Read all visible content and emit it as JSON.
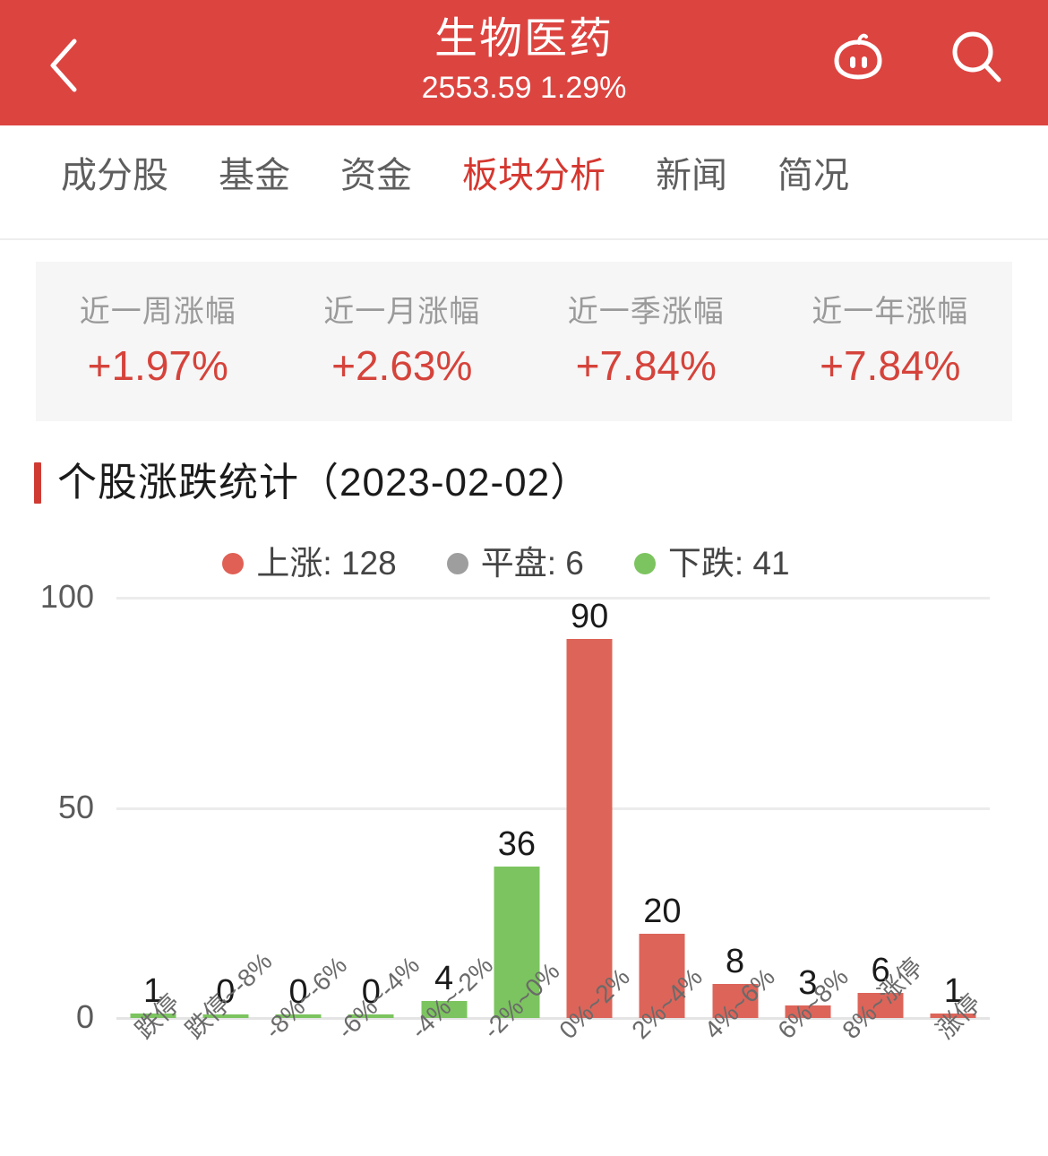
{
  "header": {
    "back_icon": "chevron-left-icon",
    "title": "生物医药",
    "subtitle": "2553.59 1.29%",
    "robot_icon": "robot-icon",
    "search_icon": "search-icon",
    "background_color": "#dc4440"
  },
  "tabs": [
    {
      "label": "成分股",
      "active": false
    },
    {
      "label": "基金",
      "active": false
    },
    {
      "label": "资金",
      "active": false
    },
    {
      "label": "板块分析",
      "active": true
    },
    {
      "label": "新闻",
      "active": false
    },
    {
      "label": "简况",
      "active": false
    }
  ],
  "stats": [
    {
      "label": "近一周涨幅",
      "value": "+1.97%"
    },
    {
      "label": "近一月涨幅",
      "value": "+2.63%"
    },
    {
      "label": "近一季涨幅",
      "value": "+7.84%"
    },
    {
      "label": "近一年涨幅",
      "value": "+7.84%"
    }
  ],
  "section": {
    "title": "个股涨跌统计（2023-02-02）"
  },
  "legend": [
    {
      "label": "上涨: 128",
      "color": "#e06055"
    },
    {
      "label": "平盘: 6",
      "color": "#9e9e9e"
    },
    {
      "label": "下跌: 41",
      "color": "#7cc45f"
    }
  ],
  "colors": {
    "up_red": "#dd6459",
    "flat_gray": "#9e9e9e",
    "down_green": "#7cc45f",
    "brand_red": "#dc4440",
    "panel_gray": "#f6f6f6"
  },
  "chart_data": {
    "type": "bar",
    "title": "个股涨跌统计（2023-02-02）",
    "xlabel": "",
    "ylabel": "",
    "ylim": [
      0,
      100
    ],
    "yticks": [
      "0",
      "50",
      "100"
    ],
    "grid": true,
    "legend_position": "top-right",
    "categories": [
      "跌停",
      "跌停~-8%",
      "-8%~-6%",
      "-6%~-4%",
      "-4%~-2%",
      "-2%~0%",
      "0%~2%",
      "2%~4%",
      "4%~6%",
      "6%~8%",
      "8%~涨停",
      "涨停"
    ],
    "values": [
      1,
      0,
      0,
      0,
      4,
      36,
      90,
      20,
      8,
      3,
      6,
      1
    ],
    "bar_colors": [
      "#7cc45f",
      "#7cc45f",
      "#7cc45f",
      "#7cc45f",
      "#7cc45f",
      "#7cc45f",
      "#dd6459",
      "#dd6459",
      "#dd6459",
      "#dd6459",
      "#dd6459",
      "#dd6459"
    ],
    "data_labels": [
      "1",
      "0",
      "0",
      "0",
      "4",
      "36",
      "90",
      "20",
      "8",
      "3",
      "6",
      "1"
    ]
  }
}
